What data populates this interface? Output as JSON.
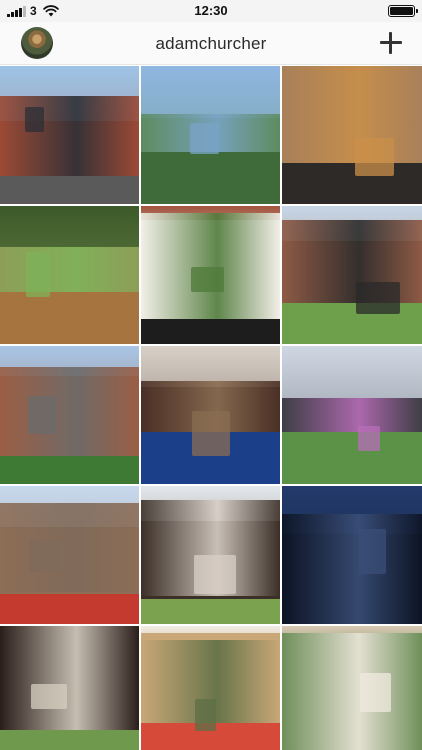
{
  "status_bar": {
    "carrier": "3",
    "time": "12:30",
    "icons": [
      "signal-icon",
      "wifi-icon",
      "battery-icon"
    ]
  },
  "header": {
    "username": "adamchurcher",
    "avatar_icon": "avatar",
    "add_icon": "plus-icon"
  },
  "grid": {
    "photos": [
      {
        "id": "tudor-house",
        "palette": [
          "#9ec3e6",
          "#9c4a35",
          "#5a5a5a",
          "#2b2f36"
        ]
      },
      {
        "id": "lake-valley",
        "palette": [
          "#8fb6e0",
          "#5d8c5f",
          "#3f6b3a",
          "#7aa3c6"
        ]
      },
      {
        "id": "bar-interior",
        "palette": [
          "#6b3e2a",
          "#a8805a",
          "#2d2a28",
          "#c98f49"
        ]
      },
      {
        "id": "lily-pond",
        "palette": [
          "#3c5a2a",
          "#8d9e56",
          "#a6743f",
          "#7fb25a"
        ]
      },
      {
        "id": "georgian-door",
        "palette": [
          "#a2553f",
          "#f2efe8",
          "#1d1d1d",
          "#4f7a3a"
        ]
      },
      {
        "id": "gothic-church",
        "palette": [
          "#c7d6e6",
          "#8e5a45",
          "#6ea04b",
          "#2a2a2a"
        ]
      },
      {
        "id": "stone-arch",
        "palette": [
          "#a8c6e6",
          "#9b5e44",
          "#3e7a34",
          "#6b6b6b"
        ]
      },
      {
        "id": "cafe-tables",
        "palette": [
          "#d8d1c8",
          "#4a2f25",
          "#1c3f8a",
          "#8a6e52"
        ]
      },
      {
        "id": "park-buildings",
        "palette": [
          "#cfd7e2",
          "#3e3e46",
          "#5c9148",
          "#b86db8"
        ]
      },
      {
        "id": "phone-box",
        "palette": [
          "#c7d9ee",
          "#8c6d56",
          "#c43a2e",
          "#7f6a5a"
        ]
      },
      {
        "id": "timber-street",
        "palette": [
          "#e4e8ec",
          "#3b2f28",
          "#7aa24f",
          "#d8cfc6"
        ]
      },
      {
        "id": "city-night",
        "palette": [
          "#233a6b",
          "#0c1324",
          "#f2c25a",
          "#3a4f78"
        ]
      },
      {
        "id": "fire-escape",
        "palette": [
          "#b44733",
          "#2a1e1a",
          "#6f9a4e",
          "#d7cfc2"
        ]
      },
      {
        "id": "brunch-table",
        "palette": [
          "#f2ede6",
          "#c9a777",
          "#d64a3a",
          "#5e6f45"
        ]
      },
      {
        "id": "apartment-block",
        "palette": [
          "#d9c9b3",
          "#6f8f5a",
          "#9d8468",
          "#f0e9df"
        ]
      }
    ]
  }
}
